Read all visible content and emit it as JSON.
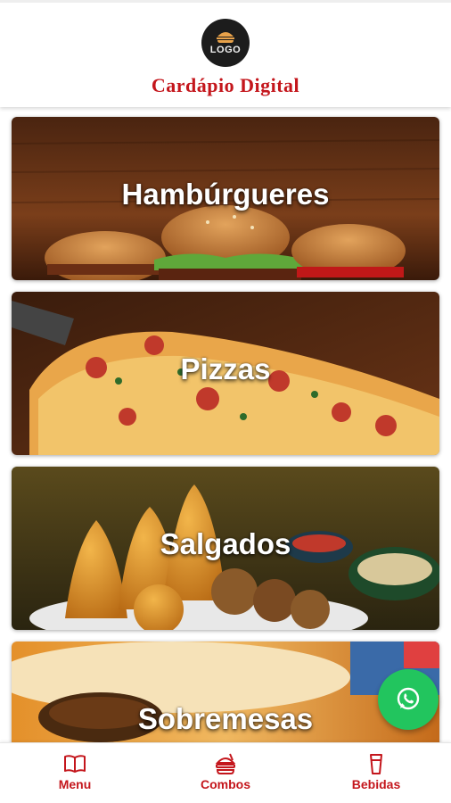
{
  "header": {
    "logo_text": "LOGO",
    "title": "Cardápio Digital"
  },
  "categories": [
    {
      "label": "Hambúrgueres"
    },
    {
      "label": "Pizzas"
    },
    {
      "label": "Salgados"
    },
    {
      "label": "Sobremesas"
    }
  ],
  "bottom_nav": [
    {
      "label": "Menu",
      "icon": "book-icon"
    },
    {
      "label": "Combos",
      "icon": "combo-icon"
    },
    {
      "label": "Bebidas",
      "icon": "drink-icon"
    }
  ],
  "whatsapp": {
    "icon": "whatsapp-icon"
  },
  "colors": {
    "accent": "#c4161c",
    "whatsapp": "#22c55e"
  }
}
